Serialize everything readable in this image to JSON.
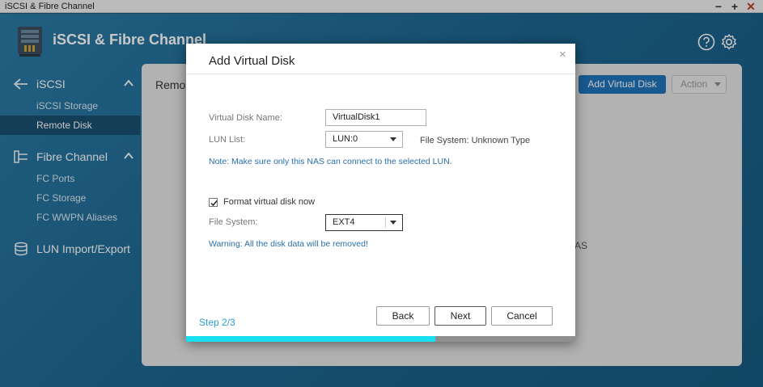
{
  "window": {
    "title": "iSCSI & Fibre Channel",
    "minimize": "−",
    "maximize": "+",
    "close": "✕"
  },
  "app": {
    "title": "iSCSI & Fibre Channel",
    "help_icon": "help-circle-icon",
    "settings_icon": "gear-icon"
  },
  "sidebar": {
    "groups": [
      {
        "label": "iSCSI",
        "icon": "iscsi-icon",
        "items": [
          {
            "label": "iSCSI Storage"
          },
          {
            "label": "Remote Disk",
            "active": true
          }
        ]
      },
      {
        "label": "Fibre Channel",
        "icon": "fibre-channel-icon",
        "items": [
          {
            "label": "FC Ports"
          },
          {
            "label": "FC Storage"
          },
          {
            "label": "FC WWPN Aliases"
          }
        ]
      },
      {
        "label": "LUN Import/Export",
        "icon": "database-icon",
        "items": []
      }
    ]
  },
  "main": {
    "title_fragment": "Remo",
    "add_button": "Add Virtual Disk",
    "action_button": "Action",
    "bg_fragment": "AS"
  },
  "modal": {
    "title": "Add Virtual Disk",
    "close": "×",
    "name_label": "Virtual Disk Name:",
    "name_value": "VirtualDisk1",
    "lun_label": "LUN List:",
    "lun_value": "LUN:0",
    "fs_info_label": "File System:",
    "fs_info_value": "Unknown Type",
    "note_prefix": "Note:",
    "note_text": "Make sure only this NAS can connect to the selected LUN.",
    "format_label": "Format virtual disk now",
    "format_checked": true,
    "fs_label": "File System:",
    "fs_value": "EXT4",
    "warning": "Warning: All the disk data will be removed!",
    "step": "Step 2/3",
    "back": "Back",
    "next": "Next",
    "cancel": "Cancel",
    "progress_fraction": 0.667,
    "accent_color": "#18e0f0"
  }
}
